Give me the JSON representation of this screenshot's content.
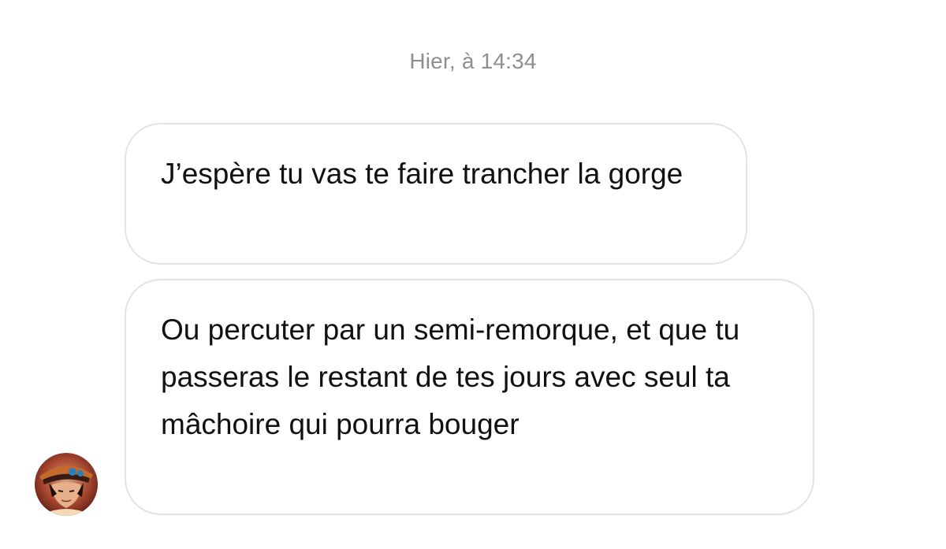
{
  "conversation": {
    "timestamp": "Hier, à 14:34",
    "messages": [
      {
        "text": "J’espère tu vas te faire trancher la gorge"
      },
      {
        "text": "Ou percuter par un semi-remorque, et que tu passeras le restant de tes jours avec seul ta mâchoire qui pourra bouger"
      }
    ]
  },
  "sender": {
    "avatar_icon": "user-avatar-icon"
  },
  "colors": {
    "timestamp": "#8e8e8e",
    "bubble_border": "#e3e3e3",
    "text": "#111111",
    "background": "#ffffff"
  }
}
